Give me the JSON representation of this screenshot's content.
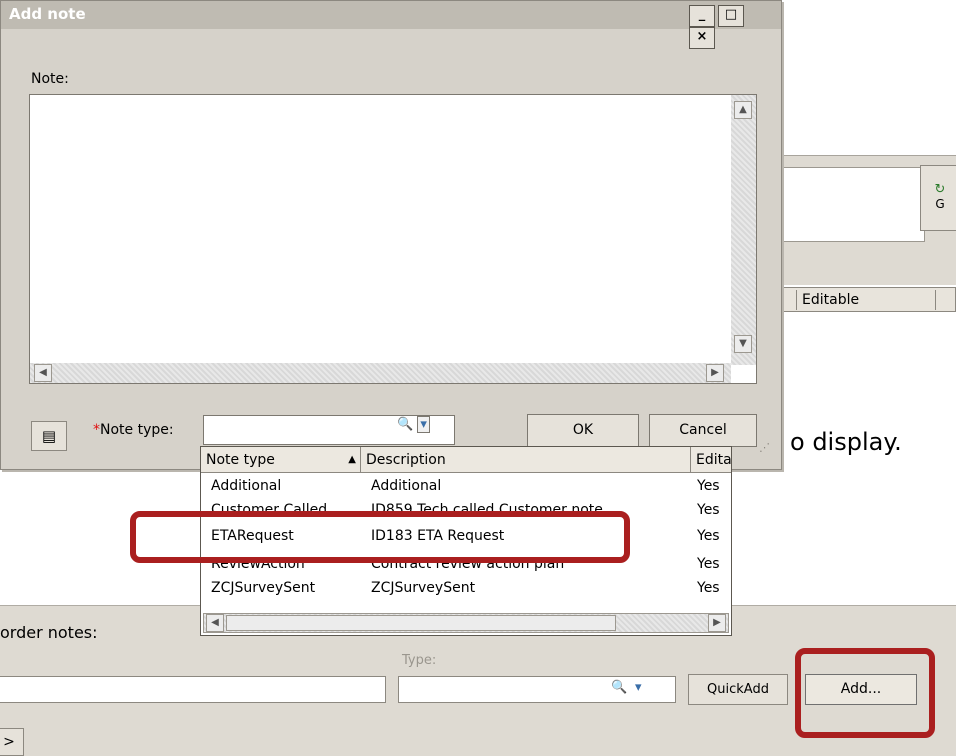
{
  "dialog": {
    "title": "Add note",
    "window_controls": [
      "_",
      "□",
      "×"
    ],
    "note_label": "Note:",
    "note_value": "",
    "note_type_required": "*",
    "note_type_label": "Note type:",
    "note_type_value": "",
    "ok_label": "OK",
    "cancel_label": "Cancel"
  },
  "dropdown": {
    "columns": [
      "Note type",
      "Description",
      "Edita"
    ],
    "rows": [
      {
        "type": "Additional",
        "description": "Additional",
        "editable": "Yes"
      },
      {
        "type": "Customer Called",
        "description": "ID859 Tech called Customer note",
        "editable": "Yes"
      },
      {
        "type": "ETARequest",
        "description": "ID183 ETA Request",
        "editable": "Yes"
      },
      {
        "type": "ReviewAction",
        "description": "Contract review action plan",
        "editable": "Yes"
      },
      {
        "type": "ZCJSurveySent",
        "description": "ZCJSurveySent",
        "editable": "Yes"
      }
    ]
  },
  "background": {
    "editable_header": "Editable",
    "empty_message_fragment": "o display.",
    "order_notes_label": "order notes:",
    "type_label": "Type:",
    "quickadd_label": "QuickAdd",
    "add_label": "Add...",
    "go_label": "G",
    "arrow_label": ">"
  },
  "colors": {
    "highlight": "#aa1f1f",
    "titlebar": "#bfbbb2",
    "required": "#e01010"
  },
  "icons": [
    "notes-icon",
    "lookup-icon",
    "dropdown-icon",
    "go-icon"
  ]
}
